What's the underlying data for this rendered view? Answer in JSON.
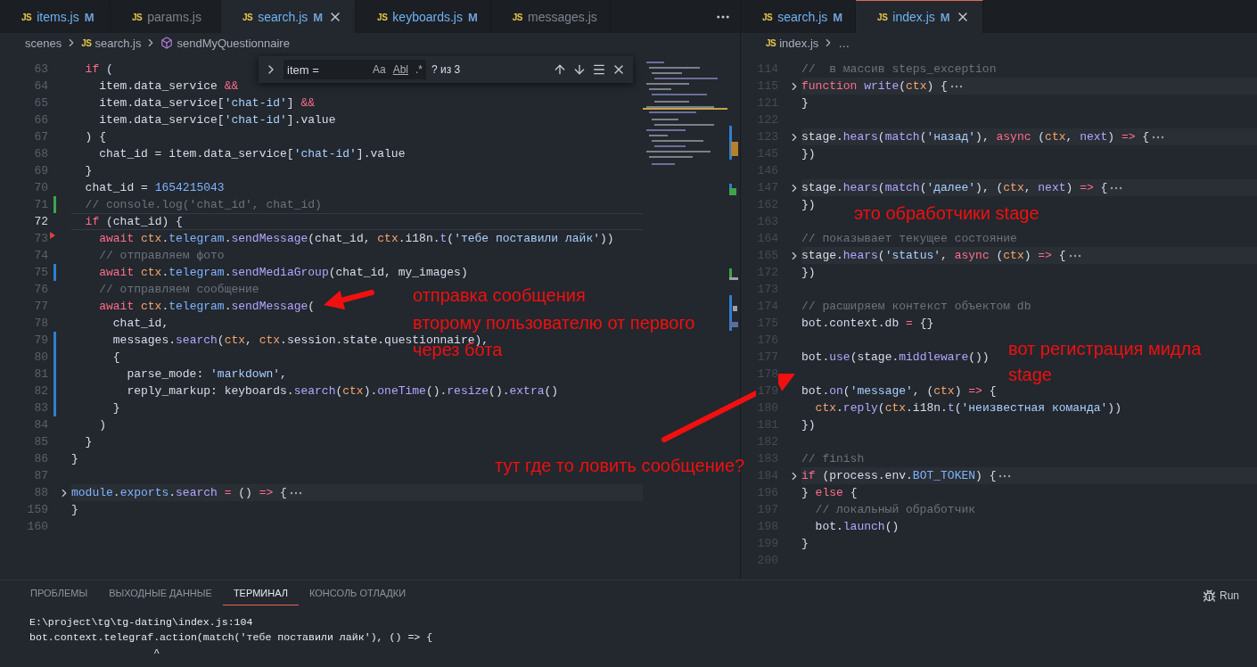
{
  "editor_groups": [
    {
      "focused": false,
      "tabs": [
        {
          "icon": "JS",
          "label": "items.js",
          "badge": "M",
          "modified": true,
          "selected": false
        },
        {
          "icon": "JS",
          "label": "params.js",
          "modified": false,
          "selected": false
        },
        {
          "icon": "JS",
          "label": "search.js",
          "badge": "M",
          "modified": true,
          "selected": true
        },
        {
          "icon": "JS",
          "label": "keyboards.js",
          "badge": "M",
          "modified": true,
          "selected": false
        },
        {
          "icon": "JS",
          "label": "messages.js",
          "modified": false,
          "selected": false
        }
      ],
      "breadcrumbs": [
        {
          "kind": "folder",
          "label": "scenes"
        },
        {
          "kind": "file",
          "icon": "JS",
          "label": "search.js"
        },
        {
          "kind": "symbol",
          "label": "sendMyQuestionnaire"
        }
      ],
      "find_widget": {
        "value": "item =",
        "options": [
          "Aa",
          "Abl",
          ".*"
        ],
        "match_count": "? из 3"
      },
      "lines": [
        {
          "number": "63",
          "kind": "plain",
          "folded": false,
          "current": false,
          "tokens": [
            {
              "text": "  if",
              "kind": "kw"
            },
            {
              "text": " (",
              "kind": "p"
            }
          ]
        },
        {
          "number": "64",
          "kind": "plain",
          "folded": false,
          "current": false,
          "tokens": [
            {
              "text": "    item.data_service ",
              "kind": "p"
            },
            {
              "text": "&&",
              "kind": "kw"
            }
          ]
        },
        {
          "number": "65",
          "kind": "plain",
          "folded": false,
          "current": false,
          "tokens": [
            {
              "text": "    item.data_service[",
              "kind": "p"
            },
            {
              "text": "'chat-id'",
              "kind": "str"
            },
            {
              "text": "] ",
              "kind": "p"
            },
            {
              "text": "&&",
              "kind": "kw"
            }
          ]
        },
        {
          "number": "66",
          "kind": "plain",
          "folded": false,
          "current": false,
          "tokens": [
            {
              "text": "    item.data_service[",
              "kind": "p"
            },
            {
              "text": "'chat-id'",
              "kind": "str"
            },
            {
              "text": "].value",
              "kind": "p"
            }
          ]
        },
        {
          "number": "67",
          "kind": "plain",
          "folded": false,
          "current": false,
          "tokens": [
            {
              "text": "  ) {",
              "kind": "p"
            }
          ]
        },
        {
          "number": "68",
          "kind": "plain",
          "folded": false,
          "current": false,
          "tokens": [
            {
              "text": "    chat_id = item.data_service[",
              "kind": "p"
            },
            {
              "text": "'chat-id'",
              "kind": "str"
            },
            {
              "text": "].value",
              "kind": "p"
            }
          ]
        },
        {
          "number": "69",
          "kind": "plain",
          "folded": false,
          "current": false,
          "tokens": [
            {
              "text": "  }",
              "kind": "p"
            }
          ]
        },
        {
          "number": "70",
          "kind": "plain",
          "folded": false,
          "current": false,
          "tokens": [
            {
              "text": "  chat_id = ",
              "kind": "p"
            },
            {
              "text": "1654215043",
              "kind": "num"
            }
          ]
        },
        {
          "number": "71",
          "kind": "added",
          "folded": false,
          "current": false,
          "tokens": [
            {
              "text": "  // console.log('chat_id', chat_id)",
              "kind": "cm"
            }
          ]
        },
        {
          "number": "72",
          "kind": "plain",
          "folded": false,
          "current": true,
          "tokens": [
            {
              "text": "  if",
              "kind": "kw"
            },
            {
              "text": " (chat_id) {",
              "kind": "p"
            }
          ]
        },
        {
          "number": "73",
          "kind": "deleted",
          "folded": false,
          "current": false,
          "tokens": [
            {
              "text": "    await ",
              "kind": "kw"
            },
            {
              "text": "ctx",
              "kind": "var"
            },
            {
              "text": ".",
              "kind": "p"
            },
            {
              "text": "telegram",
              "kind": "prop"
            },
            {
              "text": ".",
              "kind": "p"
            },
            {
              "text": "sendMessage",
              "kind": "fn"
            },
            {
              "text": "(chat_id, ",
              "kind": "p"
            },
            {
              "text": "ctx",
              "kind": "var"
            },
            {
              "text": ".i18n.",
              "kind": "p"
            },
            {
              "text": "t",
              "kind": "fn"
            },
            {
              "text": "(",
              "kind": "p"
            },
            {
              "text": "'тебе поставили лайк'",
              "kind": "str"
            },
            {
              "text": "))",
              "kind": "p"
            }
          ]
        },
        {
          "number": "74",
          "kind": "plain",
          "folded": false,
          "current": false,
          "tokens": [
            {
              "text": "    // отправляем фото",
              "kind": "cm"
            }
          ]
        },
        {
          "number": "75",
          "kind": "modified",
          "folded": false,
          "current": false,
          "tokens": [
            {
              "text": "    await ",
              "kind": "kw"
            },
            {
              "text": "ctx",
              "kind": "var"
            },
            {
              "text": ".",
              "kind": "p"
            },
            {
              "text": "telegram",
              "kind": "prop"
            },
            {
              "text": ".",
              "kind": "p"
            },
            {
              "text": "sendMediaGroup",
              "kind": "fn"
            },
            {
              "text": "(chat_id, my_images)",
              "kind": "p"
            }
          ]
        },
        {
          "number": "76",
          "kind": "plain",
          "folded": false,
          "current": false,
          "tokens": [
            {
              "text": "    // отправляем сообщение",
              "kind": "cm"
            }
          ]
        },
        {
          "number": "77",
          "kind": "plain",
          "folded": false,
          "current": false,
          "tokens": [
            {
              "text": "    await ",
              "kind": "kw"
            },
            {
              "text": "ctx",
              "kind": "var"
            },
            {
              "text": ".",
              "kind": "p"
            },
            {
              "text": "telegram",
              "kind": "prop"
            },
            {
              "text": ".",
              "kind": "p"
            },
            {
              "text": "sendMessage",
              "kind": "fn"
            },
            {
              "text": "(",
              "kind": "p"
            }
          ]
        },
        {
          "number": "78",
          "kind": "plain",
          "folded": false,
          "current": false,
          "tokens": [
            {
              "text": "      chat_id,",
              "kind": "p"
            }
          ]
        },
        {
          "number": "79",
          "kind": "modified",
          "folded": false,
          "current": false,
          "tokens": [
            {
              "text": "      messages.",
              "kind": "p"
            },
            {
              "text": "search",
              "kind": "fn"
            },
            {
              "text": "(",
              "kind": "p"
            },
            {
              "text": "ctx",
              "kind": "var"
            },
            {
              "text": ", ",
              "kind": "p"
            },
            {
              "text": "ctx",
              "kind": "var"
            },
            {
              "text": ".session.state.questionnaire),",
              "kind": "p"
            }
          ]
        },
        {
          "number": "80",
          "kind": "modified",
          "folded": false,
          "current": false,
          "tokens": [
            {
              "text": "      {",
              "kind": "p"
            }
          ]
        },
        {
          "number": "81",
          "kind": "modified",
          "folded": false,
          "current": false,
          "tokens": [
            {
              "text": "        parse_mode: ",
              "kind": "p"
            },
            {
              "text": "'markdown'",
              "kind": "str"
            },
            {
              "text": ",",
              "kind": "p"
            }
          ]
        },
        {
          "number": "82",
          "kind": "modified",
          "folded": false,
          "current": false,
          "tokens": [
            {
              "text": "        reply_markup: keyboards.",
              "kind": "p"
            },
            {
              "text": "search",
              "kind": "fn"
            },
            {
              "text": "(",
              "kind": "p"
            },
            {
              "text": "ctx",
              "kind": "var"
            },
            {
              "text": ").",
              "kind": "p"
            },
            {
              "text": "oneTime",
              "kind": "fn"
            },
            {
              "text": "().",
              "kind": "p"
            },
            {
              "text": "resize",
              "kind": "fn"
            },
            {
              "text": "().",
              "kind": "p"
            },
            {
              "text": "extra",
              "kind": "fn"
            },
            {
              "text": "()",
              "kind": "p"
            }
          ]
        },
        {
          "number": "83",
          "kind": "modified",
          "folded": false,
          "current": false,
          "tokens": [
            {
              "text": "      }",
              "kind": "p"
            }
          ]
        },
        {
          "number": "84",
          "kind": "plain",
          "folded": false,
          "current": false,
          "tokens": [
            {
              "text": "    )",
              "kind": "p"
            }
          ]
        },
        {
          "number": "85",
          "kind": "plain",
          "folded": false,
          "current": false,
          "tokens": [
            {
              "text": "  }",
              "kind": "p"
            }
          ]
        },
        {
          "number": "86",
          "kind": "plain",
          "folded": false,
          "current": false,
          "tokens": [
            {
              "text": "}",
              "kind": "p"
            }
          ]
        },
        {
          "number": "87",
          "kind": "plain",
          "folded": false,
          "current": false
        },
        {
          "number": "88",
          "kind": "plain",
          "folded": true,
          "current": false,
          "tokens": [
            {
              "text": "module",
              "kind": "prop"
            },
            {
              "text": ".",
              "kind": "p"
            },
            {
              "text": "exports",
              "kind": "prop"
            },
            {
              "text": ".",
              "kind": "p"
            },
            {
              "text": "search",
              "kind": "fn"
            },
            {
              "text": " =",
              "kind": "kw"
            },
            {
              "text": " () ",
              "kind": "p"
            },
            {
              "text": "=>",
              "kind": "kw"
            },
            {
              "text": " {",
              "kind": "p"
            }
          ]
        },
        {
          "number": "159",
          "kind": "plain",
          "folded": false,
          "current": false,
          "tokens": [
            {
              "text": "}",
              "kind": "p"
            }
          ]
        },
        {
          "number": "160",
          "kind": "plain",
          "folded": false,
          "current": false
        }
      ]
    },
    {
      "focused": true,
      "tabs": [
        {
          "icon": "JS",
          "label": "search.js",
          "badge": "M",
          "modified": true,
          "selected": false
        },
        {
          "icon": "JS",
          "label": "index.js",
          "badge": "M",
          "modified": true,
          "selected": true
        }
      ],
      "breadcrumbs": [
        {
          "kind": "file",
          "icon": "JS",
          "label": "index.js"
        },
        {
          "kind": "more",
          "label": "…"
        }
      ],
      "lines": [
        {
          "number": "114",
          "kind": "plain",
          "folded": false,
          "current": false,
          "tokens": [
            {
              "text": "//  в массив steps_exception",
              "kind": "cm"
            }
          ]
        },
        {
          "number": "115",
          "kind": "plain",
          "folded": true,
          "current": false,
          "tokens": [
            {
              "text": "function ",
              "kind": "kw"
            },
            {
              "text": "write",
              "kind": "fn"
            },
            {
              "text": "(",
              "kind": "p"
            },
            {
              "text": "ctx",
              "kind": "var"
            },
            {
              "text": ") {",
              "kind": "p"
            }
          ]
        },
        {
          "number": "121",
          "kind": "plain",
          "folded": false,
          "current": false,
          "tokens": [
            {
              "text": "}",
              "kind": "p"
            }
          ]
        },
        {
          "number": "122",
          "kind": "plain",
          "folded": false,
          "current": false
        },
        {
          "number": "123",
          "kind": "plain",
          "folded": true,
          "current": false,
          "tokens": [
            {
              "text": "stage.",
              "kind": "p"
            },
            {
              "text": "hears",
              "kind": "fn"
            },
            {
              "text": "(",
              "kind": "p"
            },
            {
              "text": "match",
              "kind": "fn"
            },
            {
              "text": "(",
              "kind": "p"
            },
            {
              "text": "'назад'",
              "kind": "str"
            },
            {
              "text": "), ",
              "kind": "p"
            },
            {
              "text": "async",
              "kind": "kw"
            },
            {
              "text": " (",
              "kind": "p"
            },
            {
              "text": "ctx",
              "kind": "var"
            },
            {
              "text": ", ",
              "kind": "p"
            },
            {
              "text": "next",
              "kind": "fn"
            },
            {
              "text": ") ",
              "kind": "p"
            },
            {
              "text": "=>",
              "kind": "kw"
            },
            {
              "text": " {",
              "kind": "p"
            }
          ]
        },
        {
          "number": "145",
          "kind": "plain",
          "folded": false,
          "current": false,
          "tokens": [
            {
              "text": "})",
              "kind": "p"
            }
          ]
        },
        {
          "number": "146",
          "kind": "plain",
          "folded": false,
          "current": false
        },
        {
          "number": "147",
          "kind": "plain",
          "folded": true,
          "current": false,
          "tokens": [
            {
              "text": "stage.",
              "kind": "p"
            },
            {
              "text": "hears",
              "kind": "fn"
            },
            {
              "text": "(",
              "kind": "p"
            },
            {
              "text": "match",
              "kind": "fn"
            },
            {
              "text": "(",
              "kind": "p"
            },
            {
              "text": "'далее'",
              "kind": "str"
            },
            {
              "text": "), (",
              "kind": "p"
            },
            {
              "text": "ctx",
              "kind": "var"
            },
            {
              "text": ", ",
              "kind": "p"
            },
            {
              "text": "next",
              "kind": "fn"
            },
            {
              "text": ") ",
              "kind": "p"
            },
            {
              "text": "=>",
              "kind": "kw"
            },
            {
              "text": " {",
              "kind": "p"
            }
          ]
        },
        {
          "number": "162",
          "kind": "plain",
          "folded": false,
          "current": false,
          "tokens": [
            {
              "text": "})",
              "kind": "p"
            }
          ]
        },
        {
          "number": "163",
          "kind": "plain",
          "folded": false,
          "current": false
        },
        {
          "number": "164",
          "kind": "plain",
          "folded": false,
          "current": false,
          "tokens": [
            {
              "text": "// показывает текущее состояние",
              "kind": "cm"
            }
          ]
        },
        {
          "number": "165",
          "kind": "plain",
          "folded": true,
          "current": false,
          "tokens": [
            {
              "text": "stage.",
              "kind": "p"
            },
            {
              "text": "hears",
              "kind": "fn"
            },
            {
              "text": "(",
              "kind": "p"
            },
            {
              "text": "'status'",
              "kind": "str"
            },
            {
              "text": ", ",
              "kind": "p"
            },
            {
              "text": "async",
              "kind": "kw"
            },
            {
              "text": " (",
              "kind": "p"
            },
            {
              "text": "ctx",
              "kind": "var"
            },
            {
              "text": ") ",
              "kind": "p"
            },
            {
              "text": "=>",
              "kind": "kw"
            },
            {
              "text": " {",
              "kind": "p"
            }
          ]
        },
        {
          "number": "172",
          "kind": "plain",
          "folded": false,
          "current": false,
          "tokens": [
            {
              "text": "})",
              "kind": "p"
            }
          ]
        },
        {
          "number": "173",
          "kind": "plain",
          "folded": false,
          "current": false
        },
        {
          "number": "174",
          "kind": "plain",
          "folded": false,
          "current": false,
          "tokens": [
            {
              "text": "// расширяем контекст объектом db",
              "kind": "cm"
            }
          ]
        },
        {
          "number": "175",
          "kind": "plain",
          "folded": false,
          "current": false,
          "tokens": [
            {
              "text": "bot.context.db ",
              "kind": "p"
            },
            {
              "text": "=",
              "kind": "kw"
            },
            {
              "text": " {}",
              "kind": "p"
            }
          ]
        },
        {
          "number": "176",
          "kind": "plain",
          "folded": false,
          "current": false
        },
        {
          "number": "177",
          "kind": "plain",
          "folded": false,
          "current": false,
          "tokens": [
            {
              "text": "bot.",
              "kind": "p"
            },
            {
              "text": "use",
              "kind": "fn"
            },
            {
              "text": "(stage.",
              "kind": "p"
            },
            {
              "text": "middleware",
              "kind": "fn"
            },
            {
              "text": "())",
              "kind": "p"
            }
          ]
        },
        {
          "number": "178",
          "kind": "plain",
          "folded": false,
          "current": false
        },
        {
          "number": "179",
          "kind": "plain",
          "folded": false,
          "current": false,
          "tokens": [
            {
              "text": "bot.",
              "kind": "p"
            },
            {
              "text": "on",
              "kind": "fn"
            },
            {
              "text": "(",
              "kind": "p"
            },
            {
              "text": "'message'",
              "kind": "str"
            },
            {
              "text": ", (",
              "kind": "p"
            },
            {
              "text": "ctx",
              "kind": "var"
            },
            {
              "text": ") ",
              "kind": "p"
            },
            {
              "text": "=>",
              "kind": "kw"
            },
            {
              "text": " {",
              "kind": "p"
            }
          ]
        },
        {
          "number": "180",
          "kind": "plain",
          "folded": false,
          "current": false,
          "tokens": [
            {
              "text": "  ctx",
              "kind": "var"
            },
            {
              "text": ".",
              "kind": "p"
            },
            {
              "text": "reply",
              "kind": "fn"
            },
            {
              "text": "(",
              "kind": "p"
            },
            {
              "text": "ctx",
              "kind": "var"
            },
            {
              "text": ".i18n.",
              "kind": "p"
            },
            {
              "text": "t",
              "kind": "fn"
            },
            {
              "text": "(",
              "kind": "p"
            },
            {
              "text": "'неизвестная команда'",
              "kind": "str"
            },
            {
              "text": "))",
              "kind": "p"
            }
          ]
        },
        {
          "number": "181",
          "kind": "plain",
          "folded": false,
          "current": false,
          "tokens": [
            {
              "text": "})",
              "kind": "p"
            }
          ]
        },
        {
          "number": "182",
          "kind": "plain",
          "folded": false,
          "current": false
        },
        {
          "number": "183",
          "kind": "plain",
          "folded": false,
          "current": false,
          "tokens": [
            {
              "text": "// finish",
              "kind": "cm"
            }
          ]
        },
        {
          "number": "184",
          "kind": "plain",
          "folded": true,
          "current": false,
          "tokens": [
            {
              "text": "if",
              "kind": "kw"
            },
            {
              "text": " (process.env.",
              "kind": "p"
            },
            {
              "text": "BOT_TOKEN",
              "kind": "prop"
            },
            {
              "text": ") {",
              "kind": "p"
            }
          ]
        },
        {
          "number": "196",
          "kind": "plain",
          "folded": false,
          "current": false,
          "tokens": [
            {
              "text": "} ",
              "kind": "p"
            },
            {
              "text": "else",
              "kind": "kw"
            },
            {
              "text": " {",
              "kind": "p"
            }
          ]
        },
        {
          "number": "197",
          "kind": "plain",
          "folded": false,
          "current": false,
          "tokens": [
            {
              "text": "  // локальный обработчик",
              "kind": "cm"
            }
          ]
        },
        {
          "number": "198",
          "kind": "plain",
          "folded": false,
          "current": false,
          "tokens": [
            {
              "text": "  bot.",
              "kind": "p"
            },
            {
              "text": "launch",
              "kind": "fn"
            },
            {
              "text": "()",
              "kind": "p"
            }
          ]
        },
        {
          "number": "199",
          "kind": "plain",
          "folded": false,
          "current": false,
          "tokens": [
            {
              "text": "}",
              "kind": "p"
            }
          ]
        },
        {
          "number": "200",
          "kind": "plain",
          "folded": false,
          "current": false
        }
      ]
    }
  ],
  "annotations": [
    {
      "text": "отправка сообщения"
    },
    {
      "text": "второму пользователю от первого"
    },
    {
      "text": "через бота"
    },
    {
      "text": "это обработчики stage"
    },
    {
      "text": "вот регистрация мидла"
    },
    {
      "text": "stage"
    },
    {
      "text": "тут где то ловить сообщение?"
    }
  ],
  "panel": {
    "tabs": [
      {
        "label": "ПРОБЛЕМЫ",
        "selected": false
      },
      {
        "label": "ВЫХОДНЫЕ ДАННЫЕ",
        "selected": false
      },
      {
        "label": "ТЕРМИНАЛ",
        "selected": true
      },
      {
        "label": "КОНСОЛЬ ОТЛАДКИ",
        "selected": false
      }
    ],
    "run_label": "Run",
    "terminal_lines": [
      "E:\\project\\tg\\tg-dating\\index.js:104",
      "bot.context.telegraf.action(match('тебе поставили лайк'), () => {",
      "                    ^"
    ]
  }
}
